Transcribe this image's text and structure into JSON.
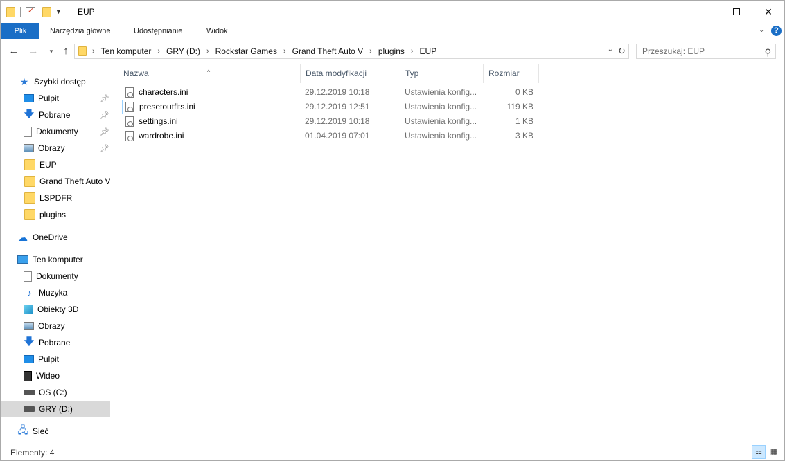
{
  "window": {
    "title": "EUP"
  },
  "ribbon": {
    "tabs": [
      "Plik",
      "Narzędzia główne",
      "Udostępnianie",
      "Widok"
    ]
  },
  "nav": {
    "breadcrumb": [
      "Ten komputer",
      "GRY (D:)",
      "Rockstar Games",
      "Grand Theft Auto V",
      "plugins",
      "EUP"
    ],
    "search_placeholder": "Przeszukaj: EUP"
  },
  "sidebar": {
    "quick_access": {
      "label": "Szybki dostęp",
      "items": [
        {
          "label": "Pulpit",
          "icon": "desktop-icon",
          "pinned": true
        },
        {
          "label": "Pobrane",
          "icon": "download-icon",
          "pinned": true
        },
        {
          "label": "Dokumenty",
          "icon": "document-icon",
          "pinned": true
        },
        {
          "label": "Obrazy",
          "icon": "pictures-icon",
          "pinned": true
        },
        {
          "label": "EUP",
          "icon": "folder-icon",
          "pinned": false
        },
        {
          "label": "Grand Theft Auto V",
          "icon": "folder-icon",
          "pinned": false
        },
        {
          "label": "LSPDFR",
          "icon": "folder-icon",
          "pinned": false
        },
        {
          "label": "plugins",
          "icon": "folder-icon",
          "pinned": false
        }
      ]
    },
    "onedrive": {
      "label": "OneDrive"
    },
    "this_pc": {
      "label": "Ten komputer",
      "items": [
        {
          "label": "Dokumenty",
          "icon": "document-icon"
        },
        {
          "label": "Muzyka",
          "icon": "music-icon"
        },
        {
          "label": "Obiekty 3D",
          "icon": "3d-objects-icon"
        },
        {
          "label": "Obrazy",
          "icon": "pictures-icon"
        },
        {
          "label": "Pobrane",
          "icon": "download-icon"
        },
        {
          "label": "Pulpit",
          "icon": "desktop-icon"
        },
        {
          "label": "Wideo",
          "icon": "video-icon"
        },
        {
          "label": "OS (C:)",
          "icon": "system-drive-icon"
        },
        {
          "label": "GRY (D:)",
          "icon": "drive-icon",
          "selected": true
        }
      ]
    },
    "network": {
      "label": "Sieć"
    }
  },
  "content": {
    "columns": [
      "Nazwa",
      "Data modyfikacji",
      "Typ",
      "Rozmiar"
    ],
    "files": [
      {
        "name": "characters.ini",
        "modified": "29.12.2019 10:18",
        "type": "Ustawienia konfig...",
        "size": "0 KB"
      },
      {
        "name": "presetoutfits.ini",
        "modified": "29.12.2019 12:51",
        "type": "Ustawienia konfig...",
        "size": "119 KB",
        "highlighted": true
      },
      {
        "name": "settings.ini",
        "modified": "29.12.2019 10:18",
        "type": "Ustawienia konfig...",
        "size": "1 KB"
      },
      {
        "name": "wardrobe.ini",
        "modified": "01.04.2019 07:01",
        "type": "Ustawienia konfig...",
        "size": "3 KB"
      }
    ]
  },
  "status": {
    "items_count": "Elementy: 4"
  }
}
